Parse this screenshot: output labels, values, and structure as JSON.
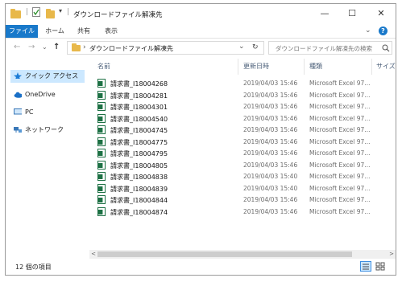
{
  "window": {
    "title": "ダウンロードファイル解凍先",
    "controls": {
      "minimize": "—",
      "maximize": "☐",
      "close": "✕"
    }
  },
  "quick_access_toolbar": {
    "separator": "|",
    "dropdown": "▾"
  },
  "ribbon": {
    "tabs": [
      "ファイル",
      "ホーム",
      "共有",
      "表示"
    ],
    "active_tab": "ファイル",
    "expand_icon": "⌄",
    "help_icon": "?"
  },
  "address_bar": {
    "back": "←",
    "forward": "→",
    "recent": "⌄",
    "up": "↑",
    "path_separator": "›",
    "path": "ダウンロードファイル解凍先",
    "dropdown": "⌄",
    "refresh": "↻"
  },
  "search": {
    "placeholder": "ダウンロードファイル解凍先の検索",
    "icon": "search-icon"
  },
  "nav_pane": {
    "items": [
      {
        "label": "クイック アクセス",
        "icon": "pin-star-icon",
        "selected": true
      },
      {
        "label": "OneDrive",
        "icon": "cloud-icon",
        "selected": false
      },
      {
        "label": "PC",
        "icon": "computer-icon",
        "selected": false
      },
      {
        "label": "ネットワーク",
        "icon": "network-icon",
        "selected": false
      }
    ]
  },
  "file_list": {
    "sort_indicator": "^",
    "columns": {
      "name": "名前",
      "date": "更新日時",
      "type": "種類",
      "size": "サイズ"
    },
    "rows": [
      {
        "name": "請求書_I18004268",
        "date": "2019/04/03 15:46",
        "type": "Microsoft Excel 97..."
      },
      {
        "name": "請求書_I18004281",
        "date": "2019/04/03 15:46",
        "type": "Microsoft Excel 97..."
      },
      {
        "name": "請求書_I18004301",
        "date": "2019/04/03 15:46",
        "type": "Microsoft Excel 97..."
      },
      {
        "name": "請求書_I18004540",
        "date": "2019/04/03 15:46",
        "type": "Microsoft Excel 97..."
      },
      {
        "name": "請求書_I18004745",
        "date": "2019/04/03 15:46",
        "type": "Microsoft Excel 97..."
      },
      {
        "name": "請求書_I18004775",
        "date": "2019/04/03 15:46",
        "type": "Microsoft Excel 97..."
      },
      {
        "name": "請求書_I18004795",
        "date": "2019/04/03 15:46",
        "type": "Microsoft Excel 97..."
      },
      {
        "name": "請求書_I18004805",
        "date": "2019/04/03 15:46",
        "type": "Microsoft Excel 97..."
      },
      {
        "name": "請求書_I18004838",
        "date": "2019/04/03 15:40",
        "type": "Microsoft Excel 97..."
      },
      {
        "name": "請求書_I18004839",
        "date": "2019/04/03 15:40",
        "type": "Microsoft Excel 97..."
      },
      {
        "name": "請求書_I18004844",
        "date": "2019/04/03 15:46",
        "type": "Microsoft Excel 97..."
      },
      {
        "name": "請求書_I18004874",
        "date": "2019/04/03 15:46",
        "type": "Microsoft Excel 97..."
      }
    ]
  },
  "scrollbar": {
    "left": "<",
    "right": ">"
  },
  "status_bar": {
    "item_count": "12 個の項目"
  },
  "colors": {
    "accent": "#1979ca",
    "selection": "#cce8ff",
    "folder": "#e8b84a",
    "excel": "#1e7145",
    "header_text": "#4c607a"
  }
}
